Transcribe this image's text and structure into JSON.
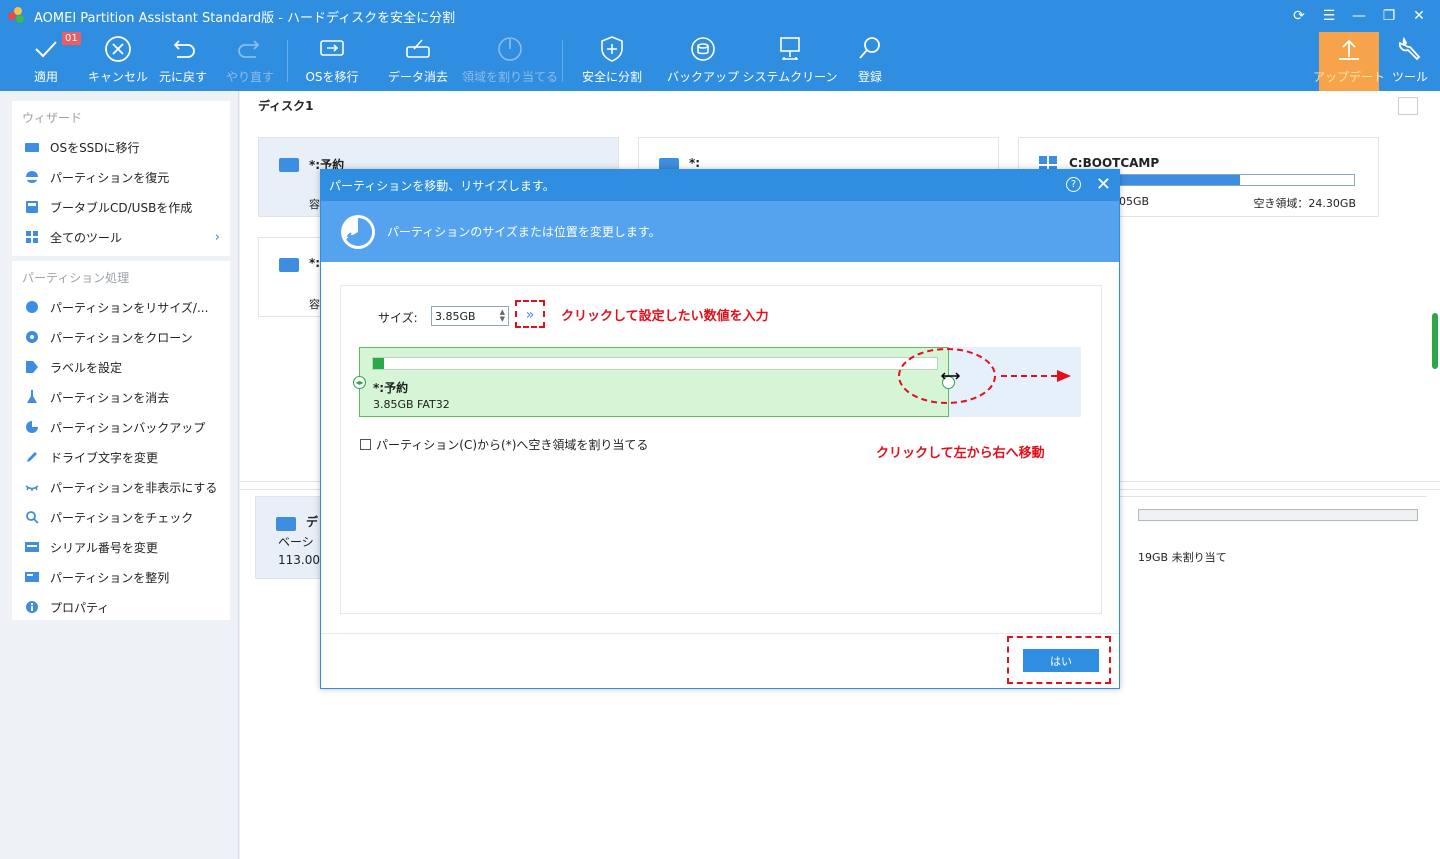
{
  "window": {
    "title": "AOMEI Partition Assistant Standard版 - ハードディスクを安全に分割"
  },
  "toolbar": {
    "badge": "01",
    "items": [
      {
        "label": "適用",
        "icon": "check-icon",
        "enabled": true
      },
      {
        "label": "キャンセル",
        "icon": "cancel-icon",
        "enabled": true
      },
      {
        "label": "元に戻す",
        "icon": "undo-icon",
        "enabled": true
      },
      {
        "label": "やり直す",
        "icon": "redo-icon",
        "enabled": false
      },
      {
        "label": "OSを移行",
        "icon": "migrate-os-icon",
        "enabled": true
      },
      {
        "label": "データ消去",
        "icon": "wipe-data-icon",
        "enabled": true
      },
      {
        "label": "領域を割り当てる",
        "icon": "allocate-space-icon",
        "enabled": false
      },
      {
        "label": "安全に分割",
        "icon": "shield-icon",
        "enabled": true
      },
      {
        "label": "バックアップ",
        "icon": "backup-icon",
        "enabled": true
      },
      {
        "label": "システムクリーン",
        "icon": "system-clean-icon",
        "enabled": true
      },
      {
        "label": "登録",
        "icon": "search-icon",
        "enabled": true
      },
      {
        "label": "アップデート",
        "icon": "update-icon",
        "enabled": true
      },
      {
        "label": "ツール",
        "icon": "wrench-icon",
        "enabled": true
      }
    ]
  },
  "wizard": {
    "heading": "ウィザード",
    "items": [
      "OSをSSDに移行",
      "パーティションを復元",
      "ブータブルCD/USBを作成",
      "全てのツール"
    ]
  },
  "partition_ops": {
    "heading": "パーティション処理",
    "items": [
      "パーティションをリサイズ/...",
      "パーティションをクローン",
      "ラベルを設定",
      "パーティションを消去",
      "パーティションバックアップ",
      "ドライブ文字を変更",
      "パーティションを非表示にする",
      "パーティションをチェック",
      "シリアル番号を変更",
      "パーティションを整列",
      "プロパティ"
    ]
  },
  "main": {
    "disk_label": "ディスク1",
    "card1": {
      "name": "*:予約",
      "info": "容"
    },
    "card2": {
      "name": "*:"
    },
    "card3": {
      "name": "C:BOOTCAMP",
      "used_text": "05GB",
      "free_text": "空き領域：24.30GB",
      "fill": 0.6
    },
    "card4": {
      "name": "*:",
      "info": "容"
    },
    "disk_card": {
      "name": "デ",
      "type": "ベーシ",
      "size": "113.00",
      "unalloc": "19GB 未割り当て"
    }
  },
  "dialog": {
    "title": "パーティションを移動、リサイズします。",
    "help": "?",
    "header": "パーティションのサイズまたは位置を変更します。",
    "size_label": "サイズ:",
    "size_value": "3.85GB",
    "go": "»",
    "partition_name": "*:予約",
    "partition_info": "3.85GB FAT32",
    "checkbox_label": "パーティション(C)から(*)へ空き領域を割り当てる",
    "ok_label": "はい",
    "used_fraction": 0.02
  },
  "annotations": {
    "size_hint": "クリックして設定したい数値を入力",
    "move_hint": "クリックして左から右へ移動"
  },
  "colors": {
    "accent": "#2f8ee0",
    "annotation": "#e3101b",
    "partition_fill": "#d6f5d6"
  }
}
